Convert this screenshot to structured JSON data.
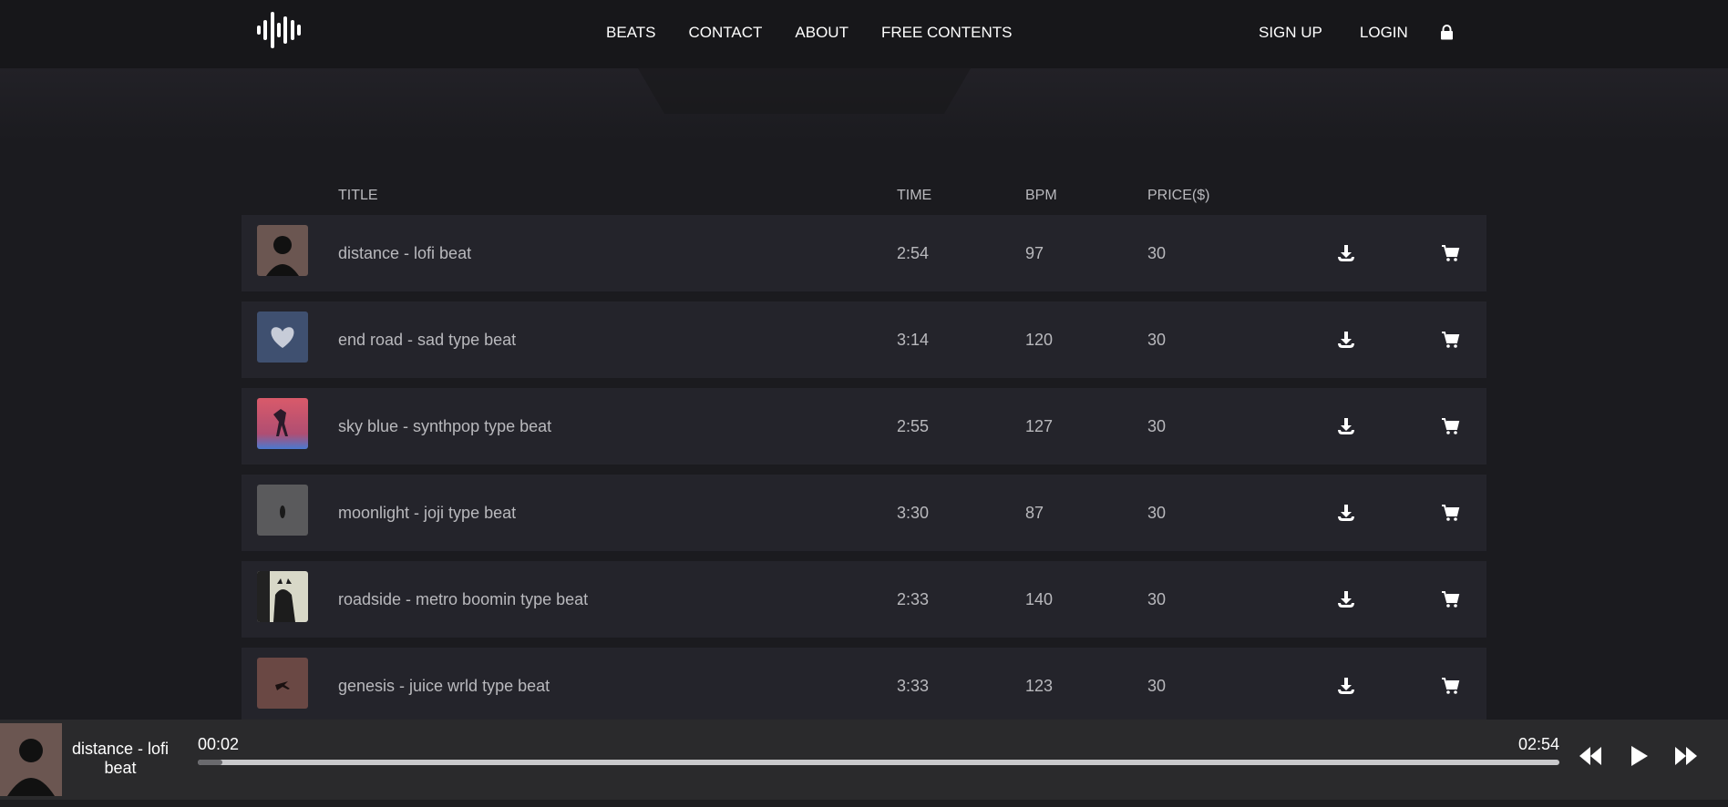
{
  "header": {
    "nav_center": [
      "BEATS",
      "CONTACT",
      "ABOUT",
      "FREE CONTENTS"
    ],
    "nav_right": [
      "SIGN UP",
      "LOGIN"
    ],
    "icons": [
      "waveform-logo-icon",
      "lock-icon"
    ]
  },
  "table": {
    "columns": [
      "TITLE",
      "TIME",
      "BPM",
      "PRICE($)"
    ],
    "rows": [
      {
        "title": "distance - lofi beat",
        "time": "2:54",
        "bpm": "97",
        "price": "30",
        "art_color": "#6b5651"
      },
      {
        "title": "end road - sad type beat",
        "time": "3:14",
        "bpm": "120",
        "price": "30",
        "art_color": "#3f5070"
      },
      {
        "title": "sky blue - synthpop type beat",
        "time": "2:55",
        "bpm": "127",
        "price": "30",
        "art_color": "#c04a5e"
      },
      {
        "title": "moonlight - joji type beat",
        "time": "3:30",
        "bpm": "87",
        "price": "30",
        "art_color": "#5a5a5c"
      },
      {
        "title": "roadside - metro boomin type beat",
        "time": "2:33",
        "bpm": "140",
        "price": "30",
        "art_color": "#d8d8c8"
      },
      {
        "title": "genesis - juice wrld type beat",
        "time": "3:33",
        "bpm": "123",
        "price": "30",
        "art_color": "#6a4844"
      }
    ],
    "row_icons": [
      "download-icon",
      "cart-icon"
    ]
  },
  "player": {
    "title": "distance - lofi beat",
    "current_time": "00:02",
    "duration": "02:54",
    "progress": 0.018,
    "controls": [
      "rewind-icon",
      "play-icon",
      "fast-forward-icon"
    ]
  }
}
